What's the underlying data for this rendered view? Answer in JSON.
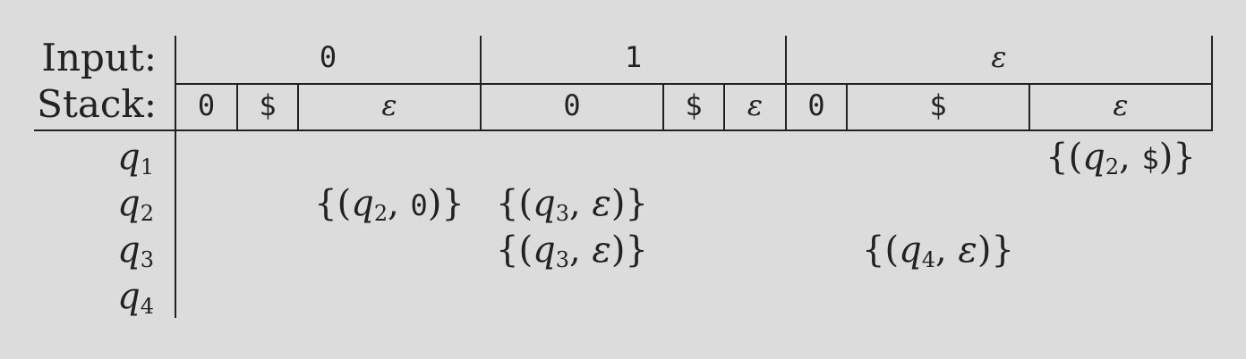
{
  "header": {
    "input_label": "Input:",
    "stack_label": "Stack:",
    "input_symbols": [
      "0",
      "1",
      "ε"
    ],
    "stack_symbols": [
      "0",
      "$",
      "ε",
      "0",
      "$",
      "ε",
      "0",
      "$",
      "ε"
    ]
  },
  "states": [
    {
      "name": "q",
      "sub": "1"
    },
    {
      "name": "q",
      "sub": "2"
    },
    {
      "name": "q",
      "sub": "3"
    },
    {
      "name": "q",
      "sub": "4"
    }
  ],
  "transitions": [
    {
      "row": 0,
      "col": 8,
      "state": "q",
      "sub": "2",
      "push": "$"
    },
    {
      "row": 1,
      "col": 2,
      "state": "q",
      "sub": "2",
      "push": "0"
    },
    {
      "row": 1,
      "col": 3,
      "state": "q",
      "sub": "3",
      "push": "ε"
    },
    {
      "row": 2,
      "col": 3,
      "state": "q",
      "sub": "3",
      "push": "ε"
    },
    {
      "row": 2,
      "col": 7,
      "state": "q",
      "sub": "4",
      "push": "ε"
    }
  ]
}
